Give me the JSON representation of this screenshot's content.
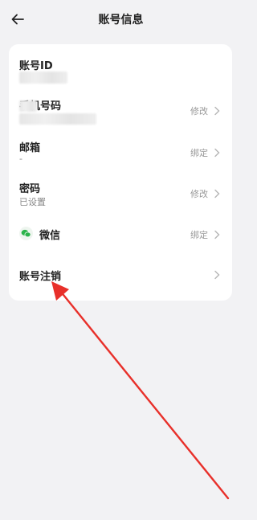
{
  "header": {
    "title": "账号信息",
    "back_icon": "arrow-left-icon"
  },
  "account_rows": [
    {
      "label": "账号ID",
      "sub": "",
      "action": ""
    },
    {
      "label": "手机号码",
      "sub": "",
      "action": "修改"
    },
    {
      "label": "邮箱",
      "sub": "-",
      "action": "绑定"
    },
    {
      "label": "密码",
      "sub": "已设置",
      "action": "修改"
    },
    {
      "label": "微信",
      "sub": "",
      "action": "绑定",
      "icon": "wechat-icon"
    },
    {
      "label": "账号注销",
      "sub": "",
      "action": ""
    }
  ],
  "colors": {
    "background": "#f2f2f4",
    "card": "#ffffff",
    "wechat": "#2bb34a",
    "annotation_arrow": "#e8302a"
  }
}
